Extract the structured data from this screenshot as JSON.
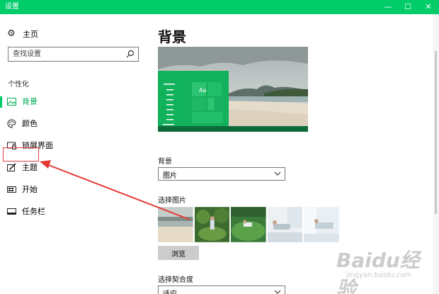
{
  "window": {
    "title": "设置",
    "controls": {
      "minimize": "—",
      "maximize": "☐",
      "close": "✕"
    },
    "accent_color": "#00cc6a"
  },
  "sidebar": {
    "home_label": "主页",
    "search": {
      "placeholder": "查找设置"
    },
    "section_label": "个性化",
    "items": [
      {
        "label": "背景",
        "icon": "picture-icon",
        "active": true
      },
      {
        "label": "颜色",
        "icon": "palette-icon",
        "active": false
      },
      {
        "label": "锁屏界面",
        "icon": "lock-screen-icon",
        "active": false
      },
      {
        "label": "主题",
        "icon": "theme-brush-icon",
        "active": false
      },
      {
        "label": "开始",
        "icon": "start-menu-icon",
        "active": false
      },
      {
        "label": "任务栏",
        "icon": "taskbar-icon",
        "active": false
      }
    ]
  },
  "main": {
    "title": "背景",
    "preview_tile_label": "Aa",
    "background_label": "背景",
    "background_value": "图片",
    "choose_picture_label": "选择图片",
    "browse_label": "浏览",
    "fit_label": "选择契合度",
    "fit_value": "适应"
  },
  "watermark": {
    "brand": "Baidu经验",
    "url": "jingyan.baidu.com"
  }
}
